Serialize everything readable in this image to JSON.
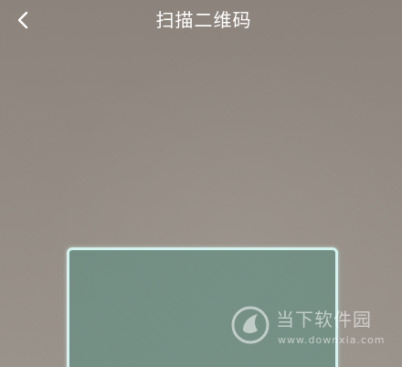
{
  "header": {
    "title": "扫描二维码",
    "back_icon": "chevron-left-icon"
  },
  "scanner": {
    "frame_color": "#d4f3ee",
    "frame_fill": "#568c80"
  },
  "watermark": {
    "name": "当下软件园",
    "url": "www.downxia.com"
  }
}
